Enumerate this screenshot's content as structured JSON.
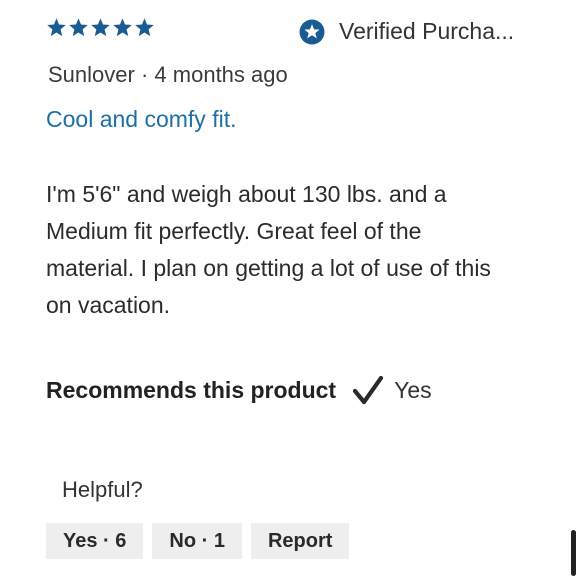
{
  "review": {
    "rating": 5,
    "rating_max": 5,
    "verified_label": "Verified Purcha...",
    "author": "Sunlover",
    "separator": "·",
    "age": "4 months ago",
    "title": "Cool and comfy fit.",
    "body": "I'm 5'6\" and weigh about 130 lbs. and a Medium fit perfectly. Great feel of the material. I plan on getting a lot of use of this on vacation.",
    "recommends_label": "Recommends this product",
    "recommends_value": "Yes"
  },
  "helpful": {
    "prompt": "Helpful?",
    "yes_label": "Yes · 6",
    "no_label": "No · 1",
    "report_label": "Report"
  },
  "icons": {
    "star": "star-icon",
    "verified": "verified-star-badge-icon",
    "check": "checkmark-icon"
  },
  "colors": {
    "star": "#1a5b92",
    "verified_badge": "#1a5b92",
    "title_link": "#1d70a3",
    "button_bg": "#eeeeee",
    "text": "#2a2a2a"
  }
}
